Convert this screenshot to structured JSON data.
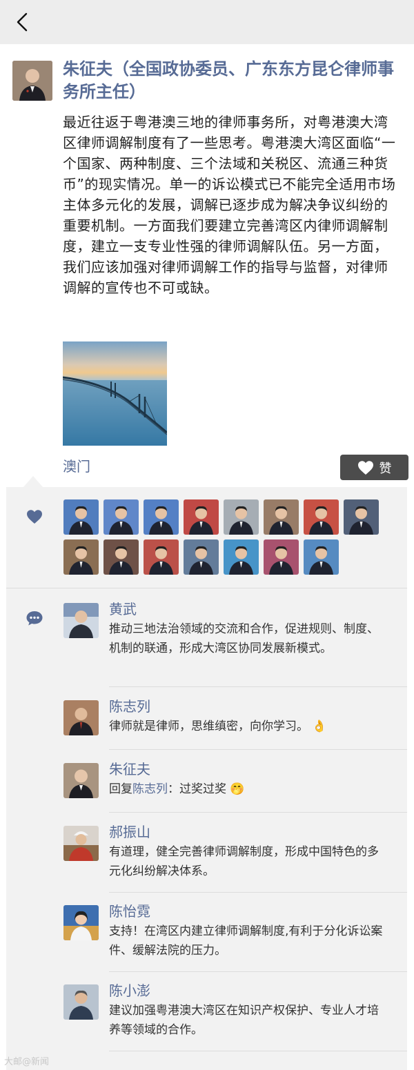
{
  "author": {
    "name": "朱征夫（全国政协委员、广东东方昆仑律师事务所主任）"
  },
  "post": {
    "text": "最近往返于粤港澳三地的律师事务所，对粤港澳大湾区律师调解制度有了一些思考。粤港澳大湾区面临“一个国家、两种制度、三个法域和关税区、流通三种货币”的现实情况。单一的诉讼模式已不能完全适用市场主体多元化的发展，调解已逐步成为解决争议纠纷的重要机制。一方面我们要建立完善湾区内律师调解制度，建立一支专业性强的律师调解队伍。另一方面，我们应该加强对律师调解工作的指导与监督，对律师调解的宣传也不可或缺。",
    "location": "澳门"
  },
  "like_button": {
    "label": "赞"
  },
  "likes": {
    "count": 15,
    "avatar_colors": [
      "#3a6bb5",
      "#4a77c2",
      "#3d6fbd",
      "#b8302c",
      "#9aa2aa",
      "#8a6a52",
      "#c0392b",
      "#3b4a66",
      "#7a5a3c",
      "#5b3a2e",
      "#b23a30",
      "#4e6a8c",
      "#2e86c1",
      "#9c3b5a",
      "#3f7bb9"
    ]
  },
  "comments": [
    {
      "name": "黄武",
      "text": "推动三地法治领域的交流和合作，促进规则、制度、机制的联通，形成大湾区协同发展新模式。",
      "avatar_color": "#5f7da6"
    },
    {
      "name": "陈志列",
      "text": "律师就是律师，思维缜密，向你学习。",
      "emoji": "👌",
      "avatar_color": "#7a3b2e"
    },
    {
      "name": "朱征夫",
      "reply_prefix": "回复",
      "reply_to": "陈志列",
      "reply_sep": "：",
      "text": "过奖过奖",
      "emoji": "🤭",
      "avatar_color": "#8a6b55"
    },
    {
      "name": "郝振山",
      "text": "有道理，健全完善律师调解制度，形成中国特色的多元化纠纷解决体系。",
      "avatar_color": "#c0392b"
    },
    {
      "name": "陈怡霓",
      "text": "支持！在湾区内建立律师调解制度,有利于分化诉讼案件、缓解法院的压力。",
      "avatar_color": "#d4a24c"
    },
    {
      "name": "陈小澎",
      "text": "建议加强粤港澳大湾区在知识产权保护、专业人才培养等领域的合作。",
      "avatar_color": "#4a6a8a"
    }
  ],
  "watermark": "大邮@新闻",
  "colors": {
    "link": "#576b95",
    "panel": "#f2f2f2",
    "like_button": "#4c4c4c"
  }
}
